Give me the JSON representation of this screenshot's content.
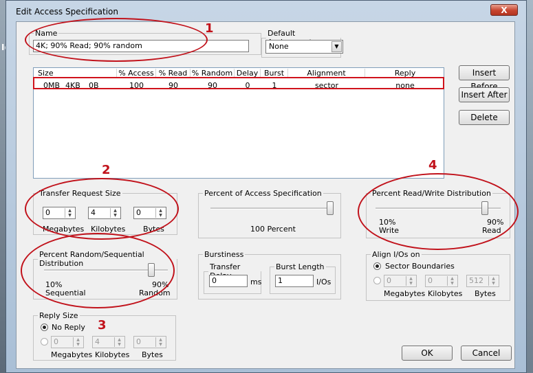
{
  "dialog": {
    "title": "Edit Access Specification",
    "close_label": "X"
  },
  "background": {
    "left_label": "Io"
  },
  "name_group": {
    "legend": "Name",
    "value": "4K; 90% Read; 90% random"
  },
  "default_assignment": {
    "legend": "Default Assignment",
    "value": "None"
  },
  "list": {
    "columns": [
      "Size",
      "% Access",
      "% Read",
      "% Random",
      "Delay",
      "Burst",
      "Alignment",
      "Reply"
    ],
    "row": [
      "0MB",
      "4KB",
      "0B",
      "100",
      "90",
      "90",
      "0",
      "1",
      "sector",
      "none"
    ]
  },
  "buttons": {
    "insert_before": "Insert Before",
    "insert_after": "Insert After",
    "delete": "Delete",
    "ok": "OK",
    "cancel": "Cancel"
  },
  "transfer_size": {
    "legend": "Transfer Request Size",
    "megabytes": "0",
    "kilobytes": "4",
    "bytes": "0",
    "megabytes_label": "Megabytes",
    "kilobytes_label": "Kilobytes",
    "bytes_label": "Bytes"
  },
  "percent_access": {
    "legend": "Percent of Access Specification",
    "caption": "100 Percent",
    "value": 100
  },
  "read_write": {
    "legend": "Percent Read/Write Distribution",
    "left_pct": "10%",
    "left_label": "Write",
    "right_pct": "90%",
    "right_label": "Read",
    "value": 90
  },
  "random_seq": {
    "legend": "Percent Random/Sequential Distribution",
    "left_pct": "10%",
    "left_label": "Sequential",
    "right_pct": "90%",
    "right_label": "Random",
    "value": 90
  },
  "burstiness": {
    "legend": "Burstiness",
    "delay_legend": "Transfer Delay",
    "delay_value": "0",
    "delay_unit": "ms",
    "length_legend": "Burst Length",
    "length_value": "1",
    "length_unit": "I/Os"
  },
  "align": {
    "legend": "Align I/Os on",
    "sector_label": "Sector Boundaries",
    "megabytes": "0",
    "kilobytes": "0",
    "bytes": "512",
    "megabytes_label": "Megabytes",
    "kilobytes_label": "Kilobytes",
    "bytes_label": "Bytes"
  },
  "reply": {
    "legend": "Reply Size",
    "no_reply_label": "No Reply",
    "megabytes": "0",
    "kilobytes": "4",
    "bytes": "0",
    "megabytes_label": "Megabytes",
    "kilobytes_label": "Kilobytes",
    "bytes_label": "Bytes"
  },
  "annotations": {
    "n1": "1",
    "n2": "2",
    "n3": "3",
    "n4": "4"
  },
  "colors": {
    "annotation": "#c1121b",
    "window_frame": "#a9bfd6",
    "client": "#f0f0f0"
  }
}
